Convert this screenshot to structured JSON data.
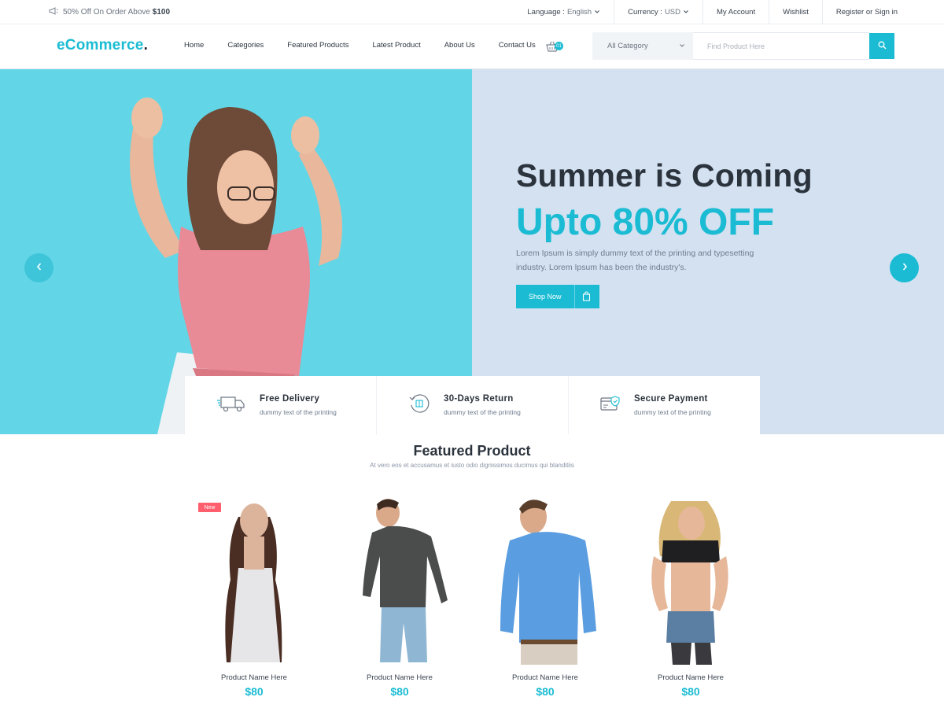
{
  "topbar": {
    "promo_text": "50% Off On Order Above",
    "promo_amount": "$100",
    "language_label": "Language :",
    "language_value": "English",
    "currency_label": "Currency :",
    "currency_value": "USD",
    "my_account": "My Account",
    "wishlist": "Wishlist",
    "register": "Register or Sign in"
  },
  "nav": {
    "logo": "eCommerce",
    "logo_dot": ".",
    "items": [
      "Home",
      "Categories",
      "Featured Products",
      "Latest Product",
      "About Us",
      "Contact Us"
    ],
    "cart_count": "01",
    "category_select": "All Category",
    "search_placeholder": "Find Product Here"
  },
  "hero": {
    "title": "Summer is Coming",
    "subtitle": "Upto 80% OFF",
    "text": "Lorem Ipsum is simply dummy text of the printing and typesetting industry. Lorem Ipsum has been the industry's.",
    "button": "Shop Now"
  },
  "features": [
    {
      "title": "Free Delivery",
      "desc": "dummy text of the printing",
      "icon": "truck-icon"
    },
    {
      "title": "30-Days Return",
      "desc": "dummy text of the printing",
      "icon": "return-icon"
    },
    {
      "title": "Secure Payment",
      "desc": "dummy text of the printing",
      "icon": "secure-payment-icon"
    }
  ],
  "featured": {
    "title": "Featured Product",
    "subtitle": "At vero eos et accusamus et iusto odio dignissimos ducimus qui blanditiis",
    "new_badge": "New",
    "products": [
      {
        "name": "Product Name Here",
        "price": "$80"
      },
      {
        "name": "Product Name Here",
        "price": "$80"
      },
      {
        "name": "Product Name Here",
        "price": "$80"
      },
      {
        "name": "Product Name Here",
        "price": "$80"
      }
    ]
  },
  "colors": {
    "accent": "#1bbcd3",
    "hero_left_bg": "#62d6e6",
    "hero_right_bg": "#d3e1f1",
    "badge": "#ff5f6d"
  }
}
